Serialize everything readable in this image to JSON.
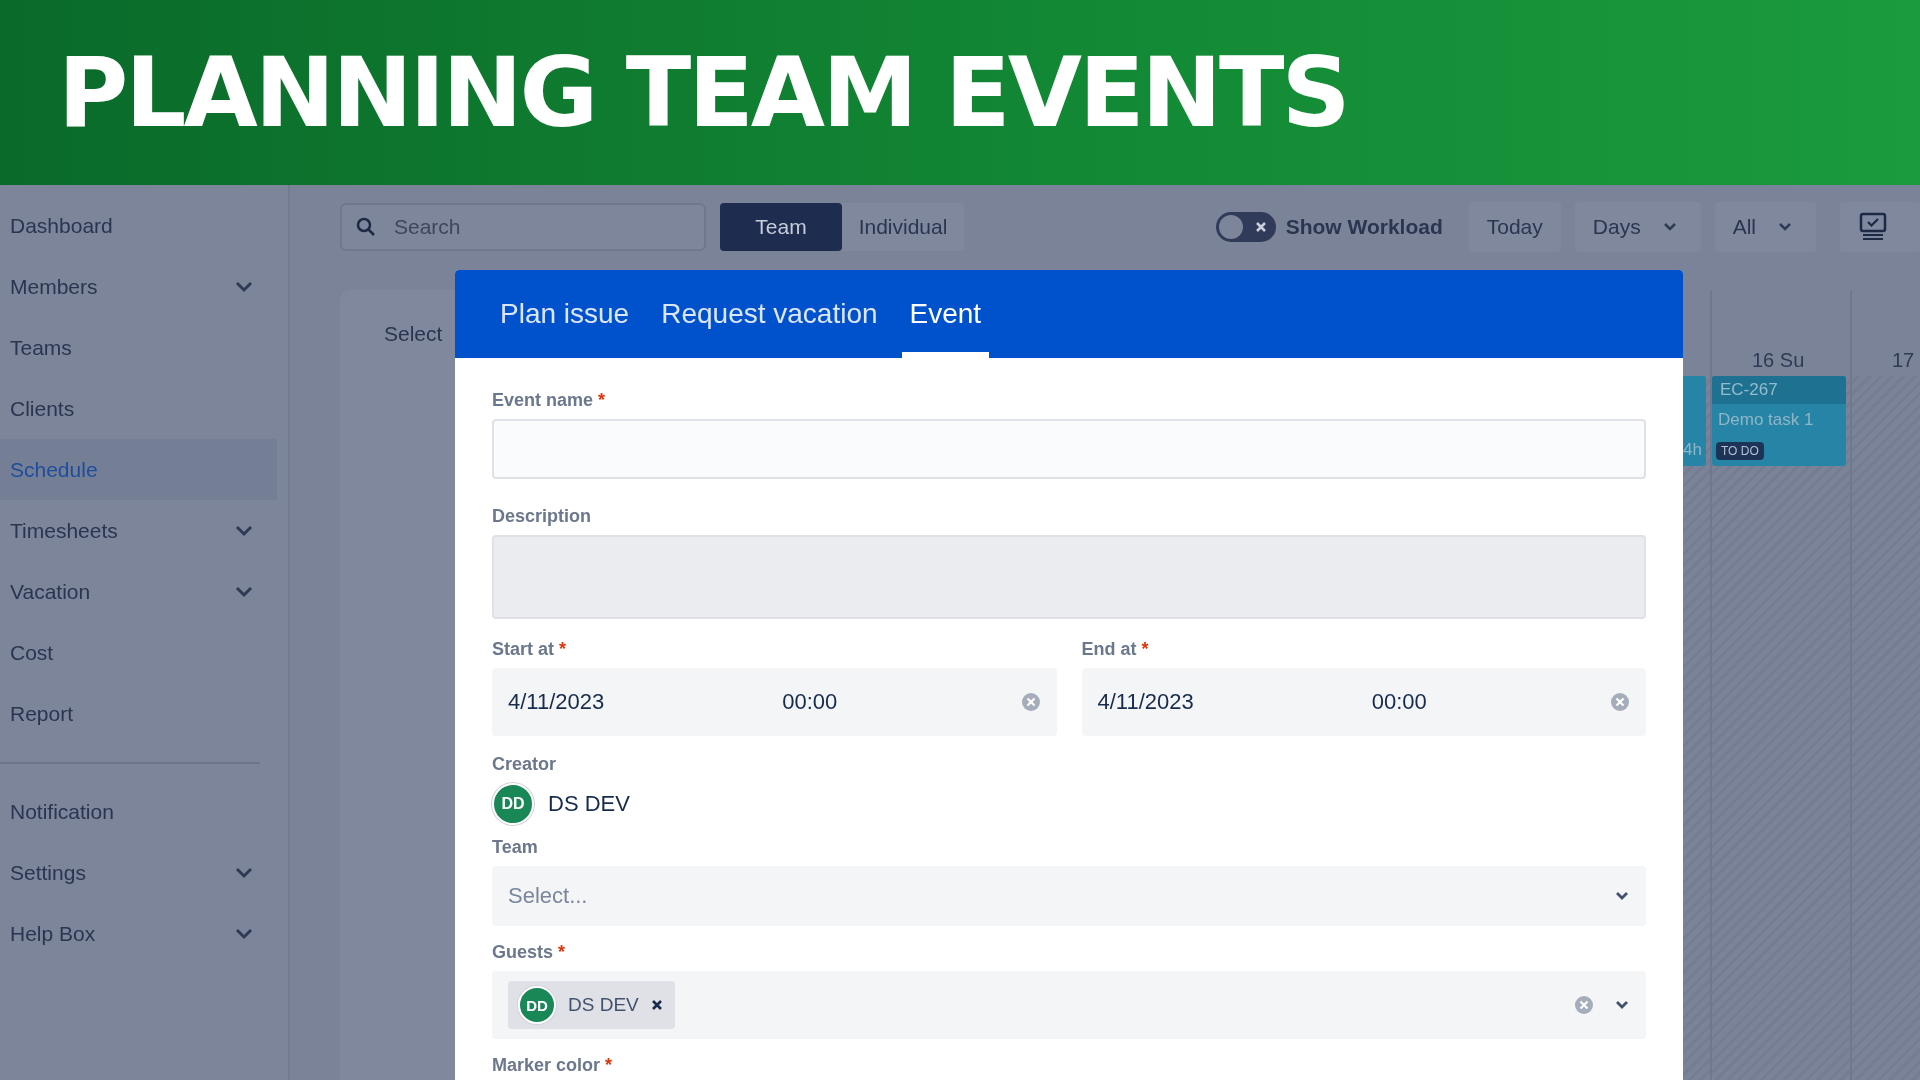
{
  "banner": {
    "title": "PLANNING TEAM EVENTS"
  },
  "sidebar": {
    "items": [
      {
        "label": "Dashboard",
        "selected": false,
        "has_submenu": false
      },
      {
        "label": "Members",
        "selected": false,
        "has_submenu": true
      },
      {
        "label": "Teams",
        "selected": false,
        "has_submenu": false
      },
      {
        "label": "Clients",
        "selected": false,
        "has_submenu": false
      },
      {
        "label": "Schedule",
        "selected": true,
        "has_submenu": false
      },
      {
        "label": "Timesheets",
        "selected": false,
        "has_submenu": true
      },
      {
        "label": "Vacation",
        "selected": false,
        "has_submenu": true
      },
      {
        "label": "Cost",
        "selected": false,
        "has_submenu": false
      },
      {
        "label": "Report",
        "selected": false,
        "has_submenu": false
      }
    ],
    "footer_items": [
      {
        "label": "Notification",
        "selected": false,
        "has_submenu": false
      },
      {
        "label": "Settings",
        "selected": false,
        "has_submenu": true
      },
      {
        "label": "Help Box",
        "selected": false,
        "has_submenu": true
      }
    ]
  },
  "toolbar": {
    "search": {
      "placeholder": "Search"
    },
    "view_modes": [
      {
        "label": "Team",
        "selected": true
      },
      {
        "label": "Individual",
        "selected": false
      }
    ],
    "show_workload": {
      "label": "Show Workload",
      "on": false
    },
    "today": "Today",
    "range": "Days",
    "filter": "All"
  },
  "board": {
    "panel_label": "Select",
    "columns": [
      {
        "task": {
          "hours": "4h"
        }
      },
      {
        "label": "16 Su",
        "task": {
          "key": "EC-267",
          "title": "Demo task 1",
          "status": "TO DO"
        }
      },
      {
        "label": "17"
      }
    ]
  },
  "modal": {
    "tabs": [
      {
        "label": "Plan issue",
        "selected": false
      },
      {
        "label": "Request vacation",
        "selected": false
      },
      {
        "label": "Event",
        "selected": true
      }
    ],
    "event_name": {
      "label": "Event name",
      "marker": "*"
    },
    "description": {
      "label": "Description"
    },
    "start": {
      "label": "Start at",
      "marker": "*",
      "date": "4/11/2023",
      "time": "00:00"
    },
    "end": {
      "label": "End at",
      "marker": "*",
      "date": "4/11/2023",
      "time": "00:00"
    },
    "creator": {
      "label": "Creator",
      "initials": "DD",
      "name": "DS DEV"
    },
    "team": {
      "label": "Team",
      "placeholder": "Select..."
    },
    "guests": {
      "label": "Guests",
      "marker": "*",
      "chips": [
        {
          "initials": "DD",
          "name": "DS DEV"
        }
      ]
    },
    "marker_color": {
      "label": "Marker color",
      "marker": "*"
    }
  }
}
